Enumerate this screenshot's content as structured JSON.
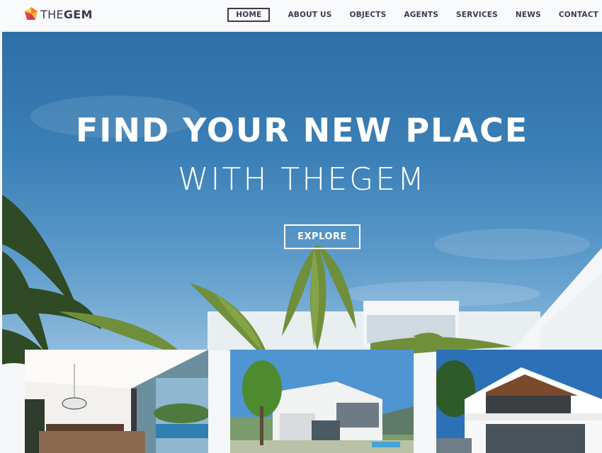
{
  "logo": {
    "prefix": "THE",
    "suffix": "GEM"
  },
  "nav": {
    "items": [
      {
        "label": "HOME",
        "active": true
      },
      {
        "label": "ABOUT US",
        "active": false
      },
      {
        "label": "OBJECTS",
        "active": false
      },
      {
        "label": "AGENTS",
        "active": false
      },
      {
        "label": "SERVICES",
        "active": false
      },
      {
        "label": "NEWS",
        "active": false
      },
      {
        "label": "CONTACT",
        "active": false
      }
    ]
  },
  "hero": {
    "headline": "FIND YOUR NEW PLACE",
    "subheadline": "WITH THEGEM",
    "button_label": "EXPLORE"
  },
  "colors": {
    "text_dark": "#3c3950",
    "sky_top": "#2d6fa6",
    "sky_bottom": "#a9cce6",
    "palm": "#6f8f3a",
    "white": "#ffffff"
  },
  "cards": [
    {
      "icon": "interior-photo"
    },
    {
      "icon": "villa-photo"
    },
    {
      "icon": "modern-house-photo"
    }
  ]
}
